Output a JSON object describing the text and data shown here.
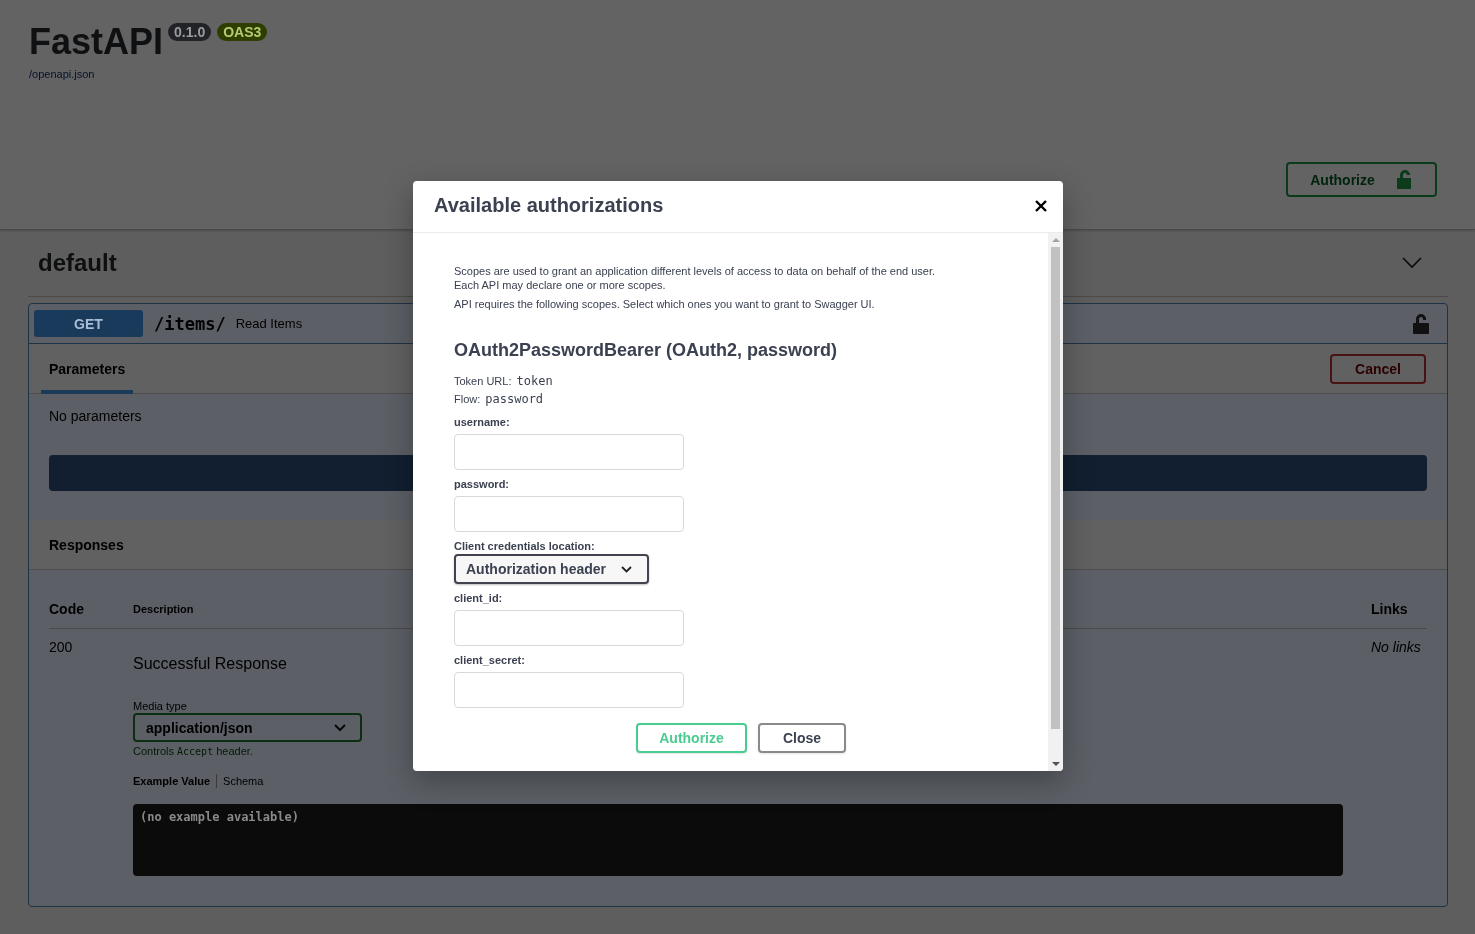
{
  "header": {
    "title": "FastAPI",
    "version": "0.1.0",
    "spec": "OAS3",
    "link": "/openapi.json"
  },
  "scheme": {
    "authorize_button": "Authorize"
  },
  "section": {
    "title": "default",
    "expanded": true
  },
  "operation": {
    "method": "GET",
    "path": "/items/",
    "summary": "Read Items",
    "tabs": [
      {
        "label": "Parameters",
        "selected": true
      }
    ],
    "cancel_button": "Cancel",
    "no_parameters": "No parameters",
    "responses_title": "Responses",
    "columns": [
      "Code",
      "Description",
      "Links"
    ],
    "responses": [
      {
        "code": "200",
        "description": "Successful Response",
        "media_type_label": "Media type",
        "media_type": "application/json",
        "hint_before": "Controls",
        "hint_code": "Accept",
        "hint_after": "header.",
        "example_tabs": [
          {
            "label": "Example Value",
            "selected": true
          },
          {
            "label": "Schema",
            "selected": false
          }
        ],
        "example": "(no example available)",
        "links": "No links"
      }
    ]
  },
  "modal": {
    "title": "Available authorizations",
    "intro": [
      "Scopes are used to grant an application different levels of access to data on behalf of the end user.",
      "Each API may declare one or more scopes."
    ],
    "scopes_note": "API requires the following scopes. Select which ones you want to grant to Swagger UI.",
    "scheme_title": "OAuth2PasswordBearer (OAuth2, password)",
    "token_url_label": "Token URL:",
    "token_url": "token",
    "flow_label": "Flow:",
    "flow": "password",
    "fields": [
      {
        "label": "username:",
        "kind": "text"
      },
      {
        "label": "password:",
        "kind": "password"
      },
      {
        "label": "Client credentials location:",
        "kind": "select",
        "value": "Authorization header"
      },
      {
        "label": "client_id:",
        "kind": "text"
      },
      {
        "label": "client_secret:",
        "kind": "password"
      }
    ],
    "buttons": [
      {
        "label": "Authorize",
        "kind": "primary"
      },
      {
        "label": "Close",
        "kind": "secondary"
      }
    ]
  }
}
